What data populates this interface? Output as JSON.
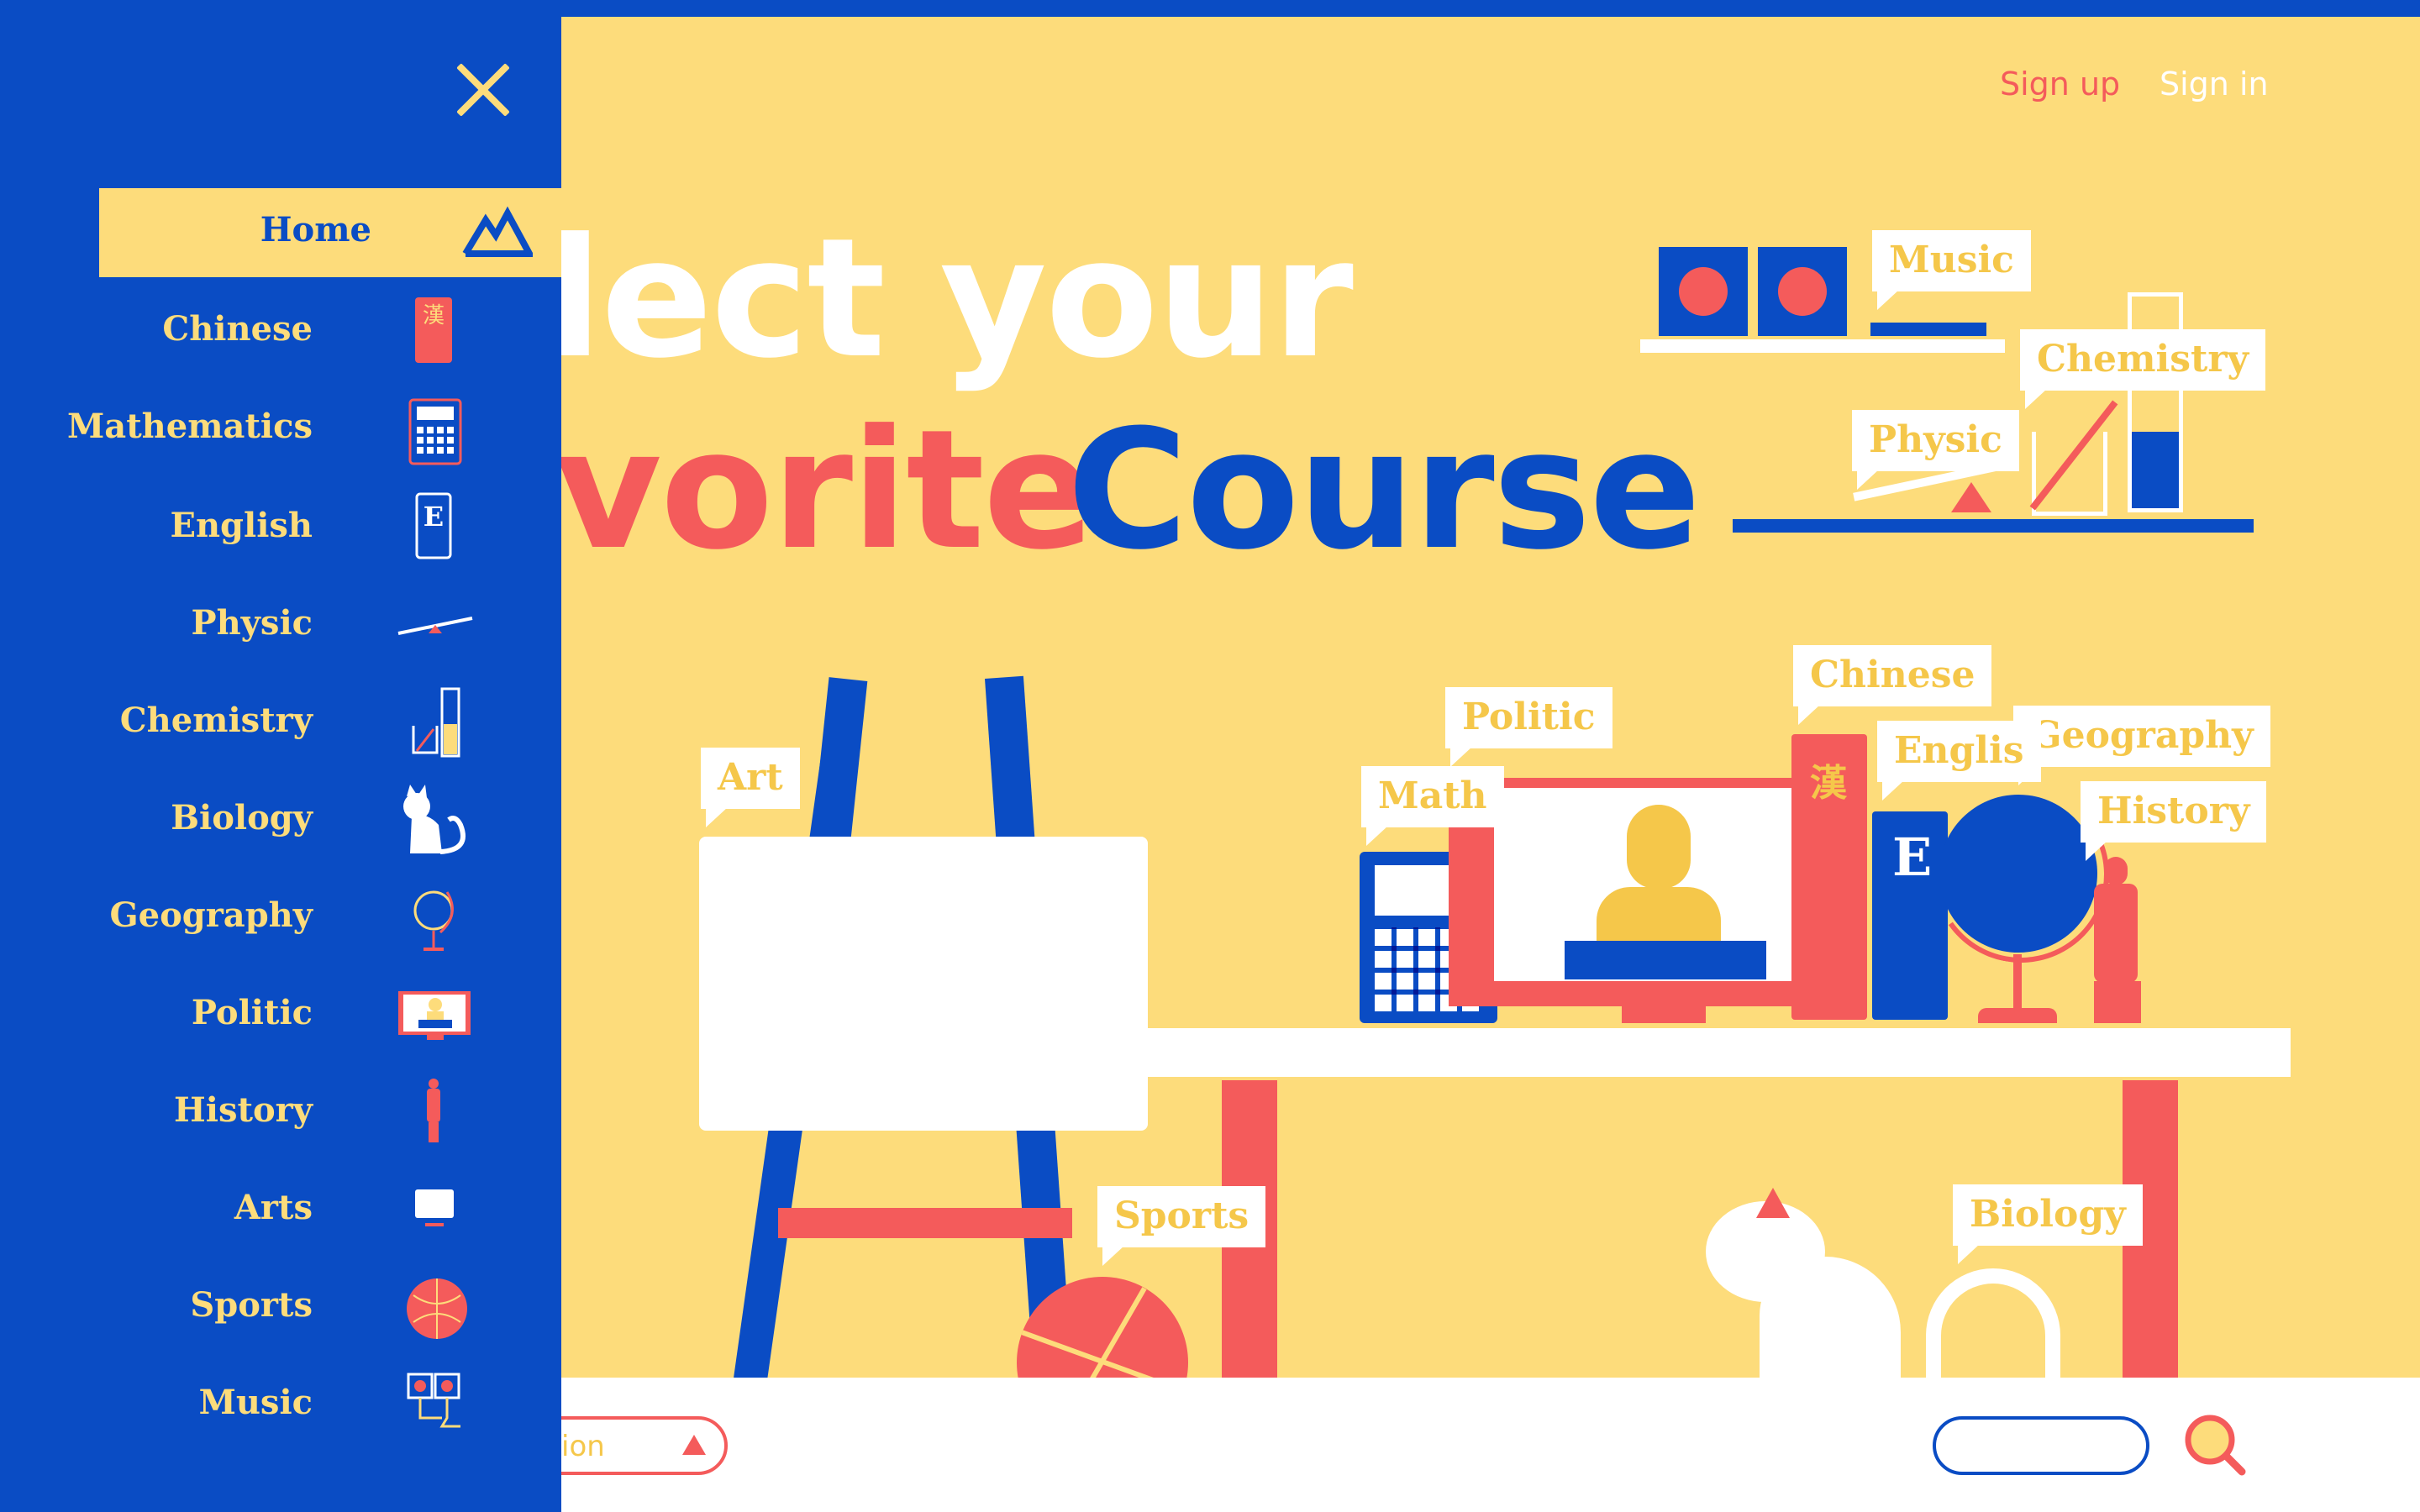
{
  "header": {
    "signup_label": "Sign up",
    "signin_label": "Sign in"
  },
  "hero": {
    "line1": "lect your",
    "line2_accent": "vorite",
    "line2_course": "Course"
  },
  "scene_labels": {
    "music": "Music",
    "chemistry": "Chemistry",
    "physic": "Physic",
    "chinese": "Chinese",
    "politic": "Politic",
    "geography": "Geography",
    "english": "Englis",
    "math": "Math",
    "history": "History",
    "art": "Art",
    "sports": "Sports",
    "biology": "Biology"
  },
  "scene_glyphs": {
    "chinese_char": "漢",
    "english_letter": "E"
  },
  "footer": {
    "filter_text": "ion",
    "search_placeholder": ""
  },
  "sidebar": {
    "home_label": "Home",
    "items": [
      {
        "label": "Chinese",
        "icon": "chinese-book-icon"
      },
      {
        "label": "Mathematics",
        "icon": "calculator-icon"
      },
      {
        "label": "English",
        "icon": "english-book-icon"
      },
      {
        "label": "Physic",
        "icon": "seesaw-icon"
      },
      {
        "label": "Chemistry",
        "icon": "beaker-icon"
      },
      {
        "label": "Biology",
        "icon": "cat-icon"
      },
      {
        "label": "Geography",
        "icon": "globe-icon"
      },
      {
        "label": "Politic",
        "icon": "monitor-speaker-icon"
      },
      {
        "label": "History",
        "icon": "statue-icon"
      },
      {
        "label": "Arts",
        "icon": "canvas-icon"
      },
      {
        "label": "Sports",
        "icon": "basketball-icon"
      },
      {
        "label": "Music",
        "icon": "speakers-icon"
      }
    ]
  },
  "colors": {
    "background": "#FDDC7B",
    "blue": "#0A4CC4",
    "red": "#F45B5B",
    "white": "#FFFFFF",
    "label_yellow": "#F5C74A"
  }
}
